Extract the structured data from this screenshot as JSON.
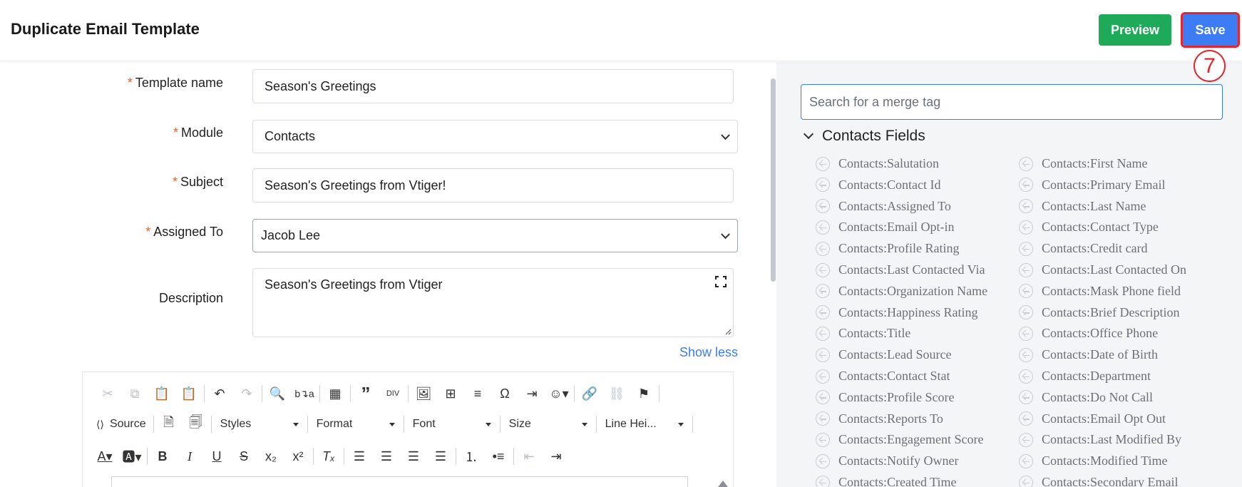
{
  "header": {
    "title": "Duplicate Email Template",
    "preview_label": "Preview",
    "save_label": "Save",
    "step_marker": "7"
  },
  "form": {
    "template_name": {
      "label": "Template name",
      "value": "Season's Greetings"
    },
    "module": {
      "label": "Module",
      "value": "Contacts"
    },
    "subject": {
      "label": "Subject",
      "value": "Season's Greetings from Vtiger!"
    },
    "assigned_to": {
      "label": "Assigned To",
      "value": "Jacob Lee"
    },
    "description": {
      "label": "Description",
      "value": "Season's Greetings from Vtiger"
    },
    "required_mark": "*",
    "show_less": "Show less"
  },
  "editor": {
    "source_label": "Source",
    "combos": [
      "Styles",
      "Format",
      "Font",
      "Size",
      "Line Hei..."
    ]
  },
  "merge_tags": {
    "search_placeholder": "Search for a merge tag",
    "section_title": "Contacts Fields",
    "left_column": [
      "Contacts:Salutation",
      "Contacts:Contact Id",
      "Contacts:Assigned To",
      "Contacts:Email Opt-in",
      "Contacts:Profile Rating",
      "Contacts:Last Contacted Via",
      "Contacts:Organization Name",
      "Contacts:Happiness Rating",
      "Contacts:Title",
      "Contacts:Lead Source",
      "Contacts:Contact Stat",
      "Contacts:Profile Score",
      "Contacts:Reports To",
      "Contacts:Engagement Score",
      "Contacts:Notify Owner",
      "Contacts:Created Time"
    ],
    "right_column": [
      "Contacts:First Name",
      "Contacts:Primary Email",
      "Contacts:Last Name",
      "Contacts:Contact Type",
      "Contacts:Credit card",
      "Contacts:Last Contacted On",
      "Contacts:Mask Phone field",
      "Contacts:Brief Description",
      "Contacts:Office Phone",
      "Contacts:Date of Birth",
      "Contacts:Department",
      "Contacts:Do Not Call",
      "Contacts:Email Opt Out",
      "Contacts:Last Modified By",
      "Contacts:Modified Time",
      "Contacts:Secondary Email"
    ]
  }
}
